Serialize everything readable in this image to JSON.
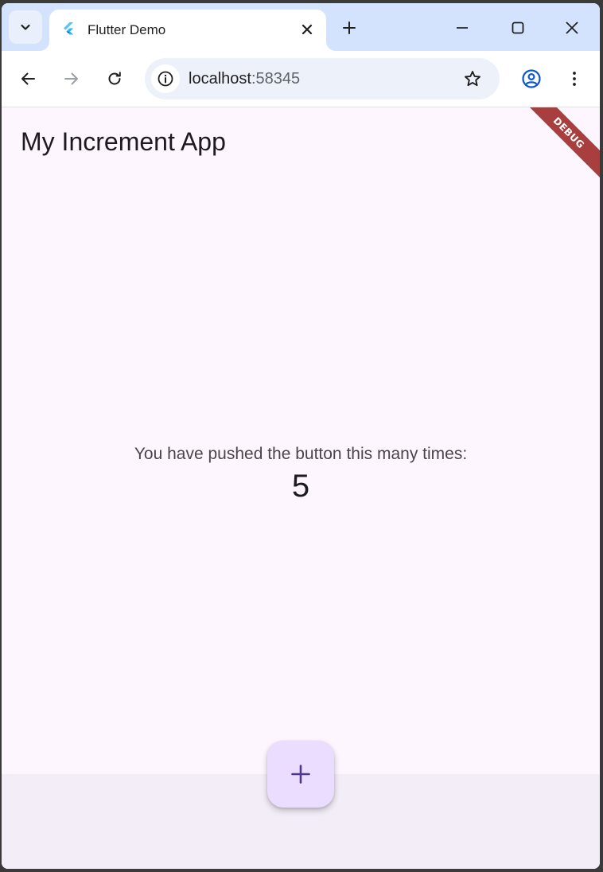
{
  "browser": {
    "tab": {
      "title": "Flutter Demo",
      "favicon": "flutter-logo-icon"
    },
    "address_bar": {
      "host": "localhost",
      "port": ":58345"
    },
    "icons": {
      "tab_search": "chevron-down-icon",
      "tab_close": "close-icon",
      "new_tab": "plus-icon",
      "minimize": "minimize-icon",
      "maximize": "maximize-icon",
      "close_window": "close-icon",
      "back": "arrow-left-icon",
      "forward": "arrow-right-icon",
      "reload": "reload-icon",
      "site_info": "info-icon",
      "bookmark": "star-icon",
      "profile": "profile-icon",
      "menu": "more-vert-icon"
    }
  },
  "app": {
    "title": "My Increment App",
    "debug_banner": "DEBUG",
    "counter_label": "You have pushed the button this many times:",
    "counter_value": "5",
    "fab_icon": "add-icon"
  },
  "colors": {
    "tabstrip_bg": "#d3e3fd",
    "page_bg": "#fdf6fe",
    "bottom_bar_bg": "#f3edf7",
    "fab_bg": "#eaddff",
    "fab_icon": "#4f378b",
    "debug_banner": "#a83e3e",
    "profile_icon": "#0b57d0"
  }
}
